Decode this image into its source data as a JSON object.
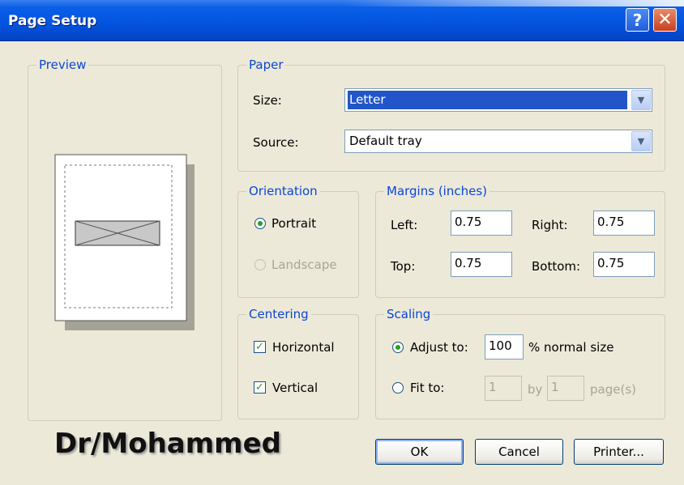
{
  "window": {
    "title": "Page Setup",
    "help_glyph": "?",
    "close_glyph": "✕"
  },
  "preview": {
    "legend": "Preview"
  },
  "paper": {
    "legend": "Paper",
    "size_label": "Size:",
    "size_value": "Letter",
    "source_label": "Source:",
    "source_value": "Default tray"
  },
  "orientation": {
    "legend": "Orientation",
    "portrait": "Portrait",
    "landscape": "Landscape",
    "selected": "Portrait"
  },
  "margins": {
    "legend": "Margins (inches)",
    "left_label": "Left:",
    "left": "0.75",
    "right_label": "Right:",
    "right": "0.75",
    "top_label": "Top:",
    "top": "0.75",
    "bottom_label": "Bottom:",
    "bottom": "0.75"
  },
  "centering": {
    "legend": "Centering",
    "horizontal": "Horizontal",
    "vertical": "Vertical",
    "horizontal_checked": true,
    "vertical_checked": true
  },
  "scaling": {
    "legend": "Scaling",
    "adjust_label": "Adjust to:",
    "adjust_value": "100",
    "adjust_suffix": "% normal size",
    "fit_label": "Fit to:",
    "fit_wide": "1",
    "fit_by": "by",
    "fit_tall": "1",
    "fit_suffix": "page(s)",
    "selected": "Adjust to"
  },
  "buttons": {
    "ok": "OK",
    "cancel": "Cancel",
    "printer": "Printer..."
  },
  "watermark": "Dr/Mohammed",
  "colors": {
    "titlebar": "#0455e0",
    "legend": "#0a46d6",
    "dialog_bg": "#ece9d8",
    "selection": "#2255c8"
  },
  "icons": {
    "dropdown": "chevron-down-icon",
    "check": "checkmark-icon"
  }
}
